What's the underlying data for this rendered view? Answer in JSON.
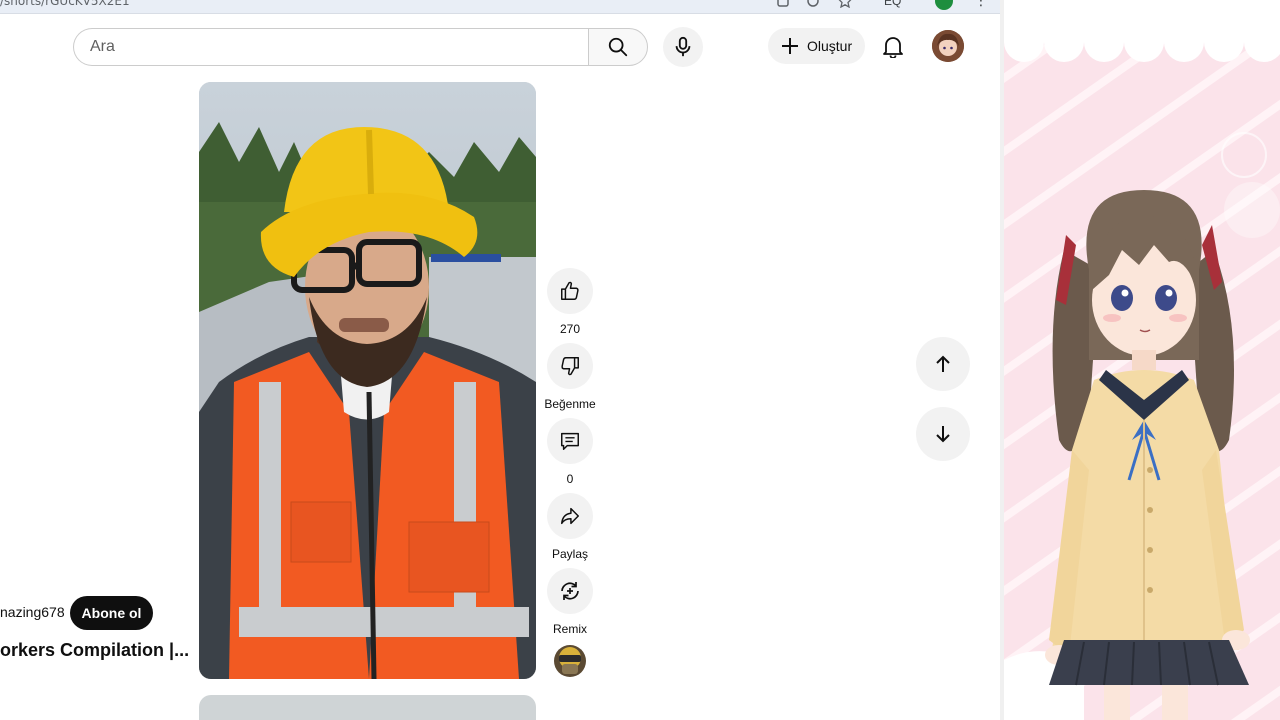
{
  "browser": {
    "url_fragment": "/shorts/rGUcKV5X2E1",
    "profile_color": "#1e8e3e",
    "toolbar_text": "EQ"
  },
  "header": {
    "search_placeholder": "Ara",
    "create_label": "Oluştur",
    "icons": [
      "search-icon",
      "mic-icon",
      "plus-icon",
      "bell-icon"
    ]
  },
  "actions": {
    "like_count": "270",
    "dislike_label": "Beğenme",
    "comment_count": "0",
    "share_label": "Paylaş",
    "remix_label": "Remix"
  },
  "meta": {
    "channel_name": "nazing678",
    "subscribe_label": "Abone ol",
    "title": "orkers Compilation |..."
  },
  "colors": {
    "accent_dark": "#0f0f0f",
    "button_bg": "#f2f2f2",
    "panel_pink": "#fbe3ea"
  }
}
